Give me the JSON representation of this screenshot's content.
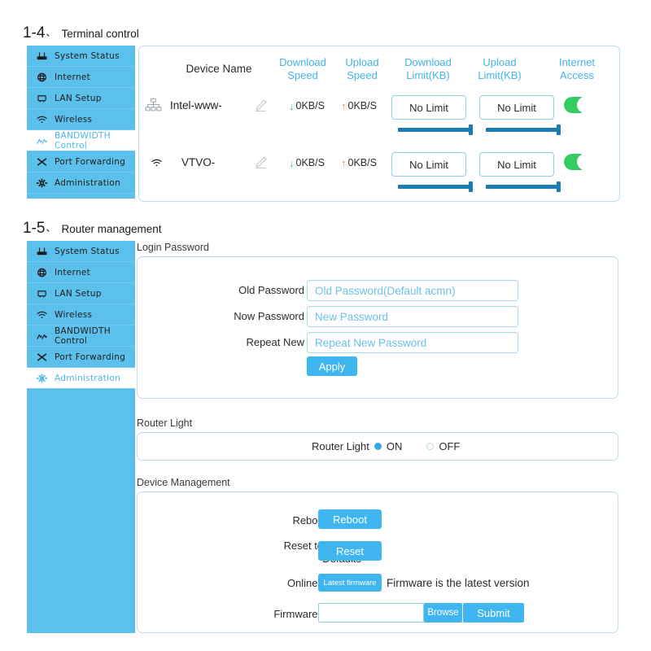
{
  "sections": {
    "terminal": {
      "number": "1-4",
      "separator": "、",
      "title": "Terminal control"
    },
    "router": {
      "number": "1-5",
      "separator": "、",
      "title": "Router management"
    }
  },
  "sidebar_top": {
    "items": [
      {
        "label": "System Status",
        "icon": "router-icon",
        "active": false
      },
      {
        "label": "Internet",
        "icon": "globe-icon",
        "active": false
      },
      {
        "label": "LAN Setup",
        "icon": "lan-port-icon",
        "active": false
      },
      {
        "label": "Wireless",
        "icon": "wifi-icon",
        "active": false
      },
      {
        "label": "BANDWIDTH Control",
        "icon": "chart-icon",
        "active": true
      },
      {
        "label": "Port Forwarding",
        "icon": "scissors-icon",
        "active": false
      },
      {
        "label": "Administration",
        "icon": "gear-icon",
        "active": false
      }
    ]
  },
  "sidebar_bottom": {
    "items": [
      {
        "label": "System Status",
        "icon": "router-icon",
        "active": false
      },
      {
        "label": "Internet",
        "icon": "globe-icon",
        "active": false
      },
      {
        "label": "LAN Setup",
        "icon": "lan-port-icon",
        "active": false
      },
      {
        "label": "Wireless",
        "icon": "wifi-icon",
        "active": false
      },
      {
        "label": "BANDWIDTH Control",
        "icon": "chart-icon",
        "active": false
      },
      {
        "label": "Port Forwarding",
        "icon": "scissors-icon",
        "active": false
      },
      {
        "label": "Administration",
        "icon": "gear-icon",
        "active": true
      }
    ]
  },
  "terminal_table": {
    "headers": {
      "device_name": "Device Name",
      "download_speed_l1": "Download",
      "download_speed_l2": "Speed",
      "upload_speed_l1": "Upload",
      "upload_speed_l2": "Speed",
      "download_limit_l1": "Download",
      "download_limit_l2": "Limit(KB)",
      "upload_limit_l1": "Upload",
      "upload_limit_l2": "Limit(KB)",
      "internet_access_l1": "Internet",
      "internet_access_l2": "Access"
    },
    "rows": [
      {
        "device_name": "Intel-www-",
        "device_icon": "ethernet-tree-icon",
        "edit_icon": "pencil-icon",
        "download_speed": "0KB/S",
        "upload_speed": "0KB/S",
        "download_limit": "No Limit",
        "upload_limit": "No Limit",
        "download_slider_pct": 100,
        "upload_slider_pct": 100,
        "internet_access_on": true
      },
      {
        "device_name": "VTVO-",
        "device_icon": "wifi-icon",
        "edit_icon": "pencil-icon",
        "download_speed": "0KB/S",
        "upload_speed": "0KB/S",
        "download_limit": "No Limit",
        "upload_limit": "No Limit",
        "download_slider_pct": 100,
        "upload_slider_pct": 100,
        "internet_access_on": true
      }
    ]
  },
  "login_password": {
    "heading": "Login  Password",
    "fields": [
      {
        "label": "Old Password",
        "placeholder": "Old Password(Default  acmn)",
        "value": ""
      },
      {
        "label": "Now Password",
        "placeholder": "New Password",
        "value": ""
      },
      {
        "label": "Repeat New",
        "placeholder": "Repeat New Password",
        "value": ""
      }
    ],
    "apply_label": "Apply"
  },
  "router_light": {
    "heading": "Router Light",
    "field_label": "Router Light",
    "options": [
      {
        "label": "ON",
        "selected": true
      },
      {
        "label": "OFF",
        "selected": false
      }
    ]
  },
  "device_management": {
    "heading": "Device Management",
    "reboot": {
      "label": "Reboot Router",
      "button": "Reboot"
    },
    "reset": {
      "label_l1": "Reset to Factory",
      "label_l2": "Defaults",
      "button": "Reset"
    },
    "online_upgrade": {
      "label": "Online Upgrade",
      "button": "Latest firmware",
      "status": "Firmware is the latest version"
    },
    "firmware_upgrade": {
      "label": "Firmware  Upgrade",
      "file_value": "",
      "browse_label": "Browse",
      "submit_label": "Submit"
    }
  },
  "colors": {
    "sidebar_blue": "#5bc0ec",
    "accent_blue": "#3fb6ef",
    "header_blue": "#45b4e8",
    "panel_border": "#b8dff0",
    "slider_blue": "#1a7cb0",
    "toggle_green": "#35cc62",
    "download_arrow": "#3cb878",
    "upload_arrow": "#e8833a"
  }
}
